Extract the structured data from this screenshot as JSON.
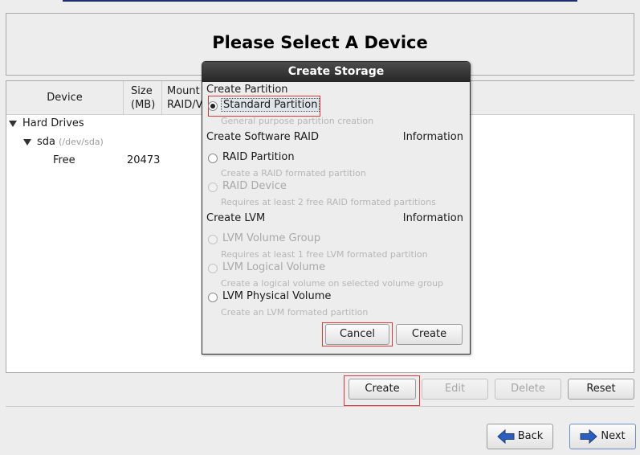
{
  "page": {
    "title": "Please Select A Device"
  },
  "table": {
    "headers": {
      "device": "Device",
      "size_line1": "Size",
      "size_line2": "(MB)",
      "mount_line1": "Mount",
      "mount_line2": "RAID/V"
    },
    "rows": {
      "hard_drives": "Hard Drives",
      "sda_name": "sda",
      "sda_path": "(/dev/sda)",
      "free_name": "Free",
      "free_size": "20473"
    }
  },
  "actions": {
    "create": "Create",
    "edit": "Edit",
    "delete": "Delete",
    "reset": "Reset"
  },
  "nav": {
    "back": "Back",
    "next": "Next"
  },
  "dialog": {
    "title": "Create Storage",
    "partition": {
      "heading": "Create Partition",
      "standard_label": "Standard Partition",
      "standard_desc": "General purpose partition creation"
    },
    "raid": {
      "heading": "Create Software RAID",
      "info": "Information",
      "partition_label": "RAID Partition",
      "partition_desc": "Create a RAID formated partition",
      "device_label": "RAID Device",
      "device_desc": "Requires at least 2 free RAID formated partitions"
    },
    "lvm": {
      "heading": "Create LVM",
      "info": "Information",
      "vg_label": "LVM Volume Group",
      "vg_desc": "Requires at least 1 free LVM formated partition",
      "lv_label": "LVM Logical Volume",
      "lv_desc": "Create a logical volume on selected volume group",
      "pv_label": "LVM Physical Volume",
      "pv_desc": "Create an LVM formated partition"
    },
    "buttons": {
      "cancel": "Cancel",
      "create": "Create"
    }
  },
  "colors": {
    "highlight_box": "#d83a3a",
    "dialog_title_bg": "#2f2f2f",
    "arrow_blue": "#2b5fbf"
  }
}
